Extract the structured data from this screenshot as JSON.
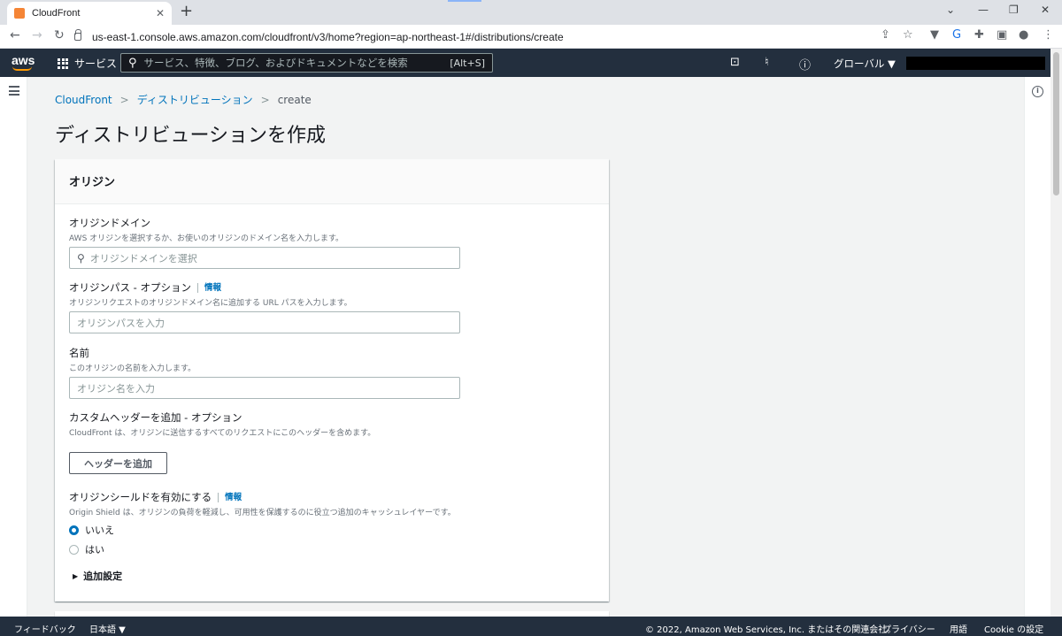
{
  "browser": {
    "tab_title": "CloudFront",
    "tab_close": "✕",
    "new_tab": "+",
    "url": "us-east-1.console.aws.amazon.com/cloudfront/v3/home?region=ap-northeast-1#/distributions/create"
  },
  "aws_header": {
    "logo": "aws",
    "services": "サービス",
    "search_placeholder": "サービス、特徴、ブログ、およびドキュメントなどを検索",
    "search_shortcut": "[Alt+S]",
    "region": "グローバル ▼"
  },
  "breadcrumb": {
    "root": "CloudFront",
    "section": "ディストリビューション",
    "current": "create"
  },
  "page_title": "ディストリビューションを作成",
  "origin_panel": {
    "header": "オリジン",
    "domain": {
      "label": "オリジンドメイン",
      "description": "AWS オリジンを選択するか、お使いのオリジンのドメイン名を入力します。",
      "placeholder": "オリジンドメインを選択"
    },
    "path": {
      "label": "オリジンパス - オプション",
      "info": "情報",
      "description": "オリジンリクエストのオリジンドメイン名に追加する URL パスを入力します。",
      "placeholder": "オリジンパスを入力"
    },
    "name": {
      "label": "名前",
      "description": "このオリジンの名前を入力します。",
      "placeholder": "オリジン名を入力"
    },
    "custom_header": {
      "label": "カスタムヘッダーを追加 - オプション",
      "description": "CloudFront は、オリジンに送信するすべてのリクエストにこのヘッダーを含めます。",
      "button": "ヘッダーを追加"
    },
    "origin_shield": {
      "label": "オリジンシールドを有効にする",
      "info": "情報",
      "description": "Origin Shield は、オリジンの負荷を軽減し、可用性を保護するのに役立つ追加のキャッシュレイヤーです。",
      "option_no": "いいえ",
      "option_yes": "はい",
      "selected": "いいえ"
    },
    "additional_settings": "追加設定"
  },
  "footer": {
    "feedback": "フィードバック",
    "language": "日本語 ▼",
    "copyright": "© 2022, Amazon Web Services, Inc. またはその関連会社。",
    "privacy": "プライバシー",
    "terms": "用語",
    "cookie": "Cookie の設定"
  },
  "colors": {
    "aws_nav": "#232f3e",
    "link": "#0073bb",
    "accent": "#ff9900",
    "background": "#f2f3f3"
  }
}
